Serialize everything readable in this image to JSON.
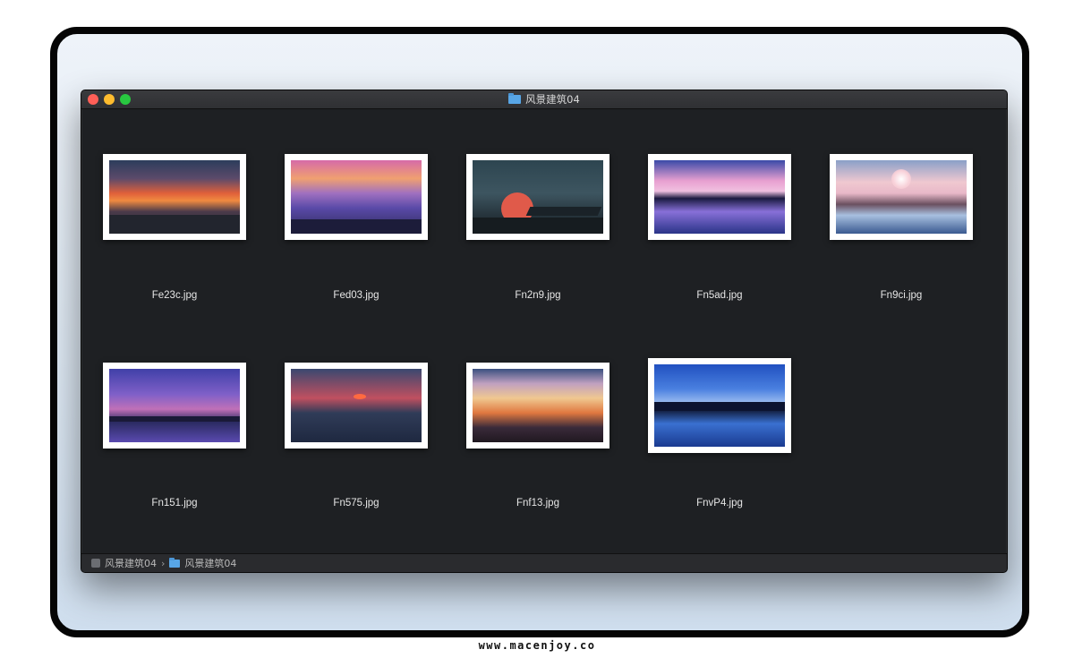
{
  "window": {
    "title": "风景建筑04"
  },
  "files": [
    {
      "name": "Fe23c.jpg"
    },
    {
      "name": "Fed03.jpg"
    },
    {
      "name": "Fn2n9.jpg"
    },
    {
      "name": "Fn5ad.jpg"
    },
    {
      "name": "Fn9ci.jpg"
    },
    {
      "name": "Fn151.jpg"
    },
    {
      "name": "Fn575.jpg"
    },
    {
      "name": "Fnf13.jpg"
    },
    {
      "name": "FnvP4.jpg"
    }
  ],
  "pathbar": {
    "root": "风景建筑04",
    "separator": "›",
    "current": "风景建筑04"
  },
  "footer": {
    "text": "www.macenjoy.co"
  },
  "colors": {
    "window_bg": "#1e2023",
    "folder": "#58a6e6",
    "close": "#ff5f57",
    "minimize": "#febc2e",
    "zoom": "#28c840"
  }
}
